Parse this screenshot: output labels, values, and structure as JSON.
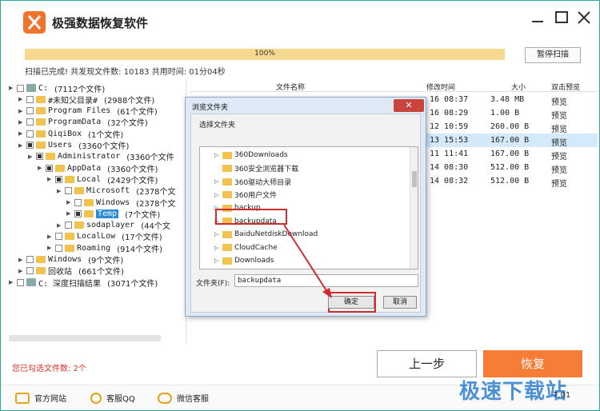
{
  "app": {
    "title": "极强数据恢复软件"
  },
  "progress": {
    "value": 1.0,
    "text": "100%"
  },
  "pause_button": "暂停扫描",
  "status": "扫描已完成! 共发现文件数: 10183  共用时间: 01分04秒",
  "tree": [
    {
      "label": "C:",
      "count": "(7112个文件)",
      "level": 0
    },
    {
      "label": "#未知父目录#",
      "count": "(2988个文件)",
      "level": 1
    },
    {
      "label": "Program Files",
      "count": "(61个文件)",
      "level": 1
    },
    {
      "label": "ProgramData",
      "count": "(32个文件)",
      "level": 1
    },
    {
      "label": "QiqiBox",
      "count": "(1个文件)",
      "level": 1
    },
    {
      "label": "Users",
      "count": "(3360个文件)",
      "level": 1
    },
    {
      "label": "Administrator",
      "count": "(3360个文件",
      "level": 2
    },
    {
      "label": "AppData",
      "count": "(3360个文件)",
      "level": 3
    },
    {
      "label": "Local",
      "count": "(2429个文件)",
      "level": 4
    },
    {
      "label": "Microsoft",
      "count": "(2378个文",
      "level": 5
    },
    {
      "label": "Windows",
      "count": "(2378个文",
      "level": 6
    },
    {
      "label": "Temp",
      "count": "(7个文件)",
      "level": 6
    },
    {
      "label": "sodaplayer",
      "count": "(44个文",
      "level": 5
    },
    {
      "label": "LocalLow",
      "count": "(17个文件)",
      "level": 4
    },
    {
      "label": "Roaming",
      "count": "(914个文件)",
      "level": 4
    },
    {
      "label": "Windows",
      "count": "(9个文件)",
      "level": 1
    },
    {
      "label": "回收站",
      "count": "(661个文件)",
      "level": 1
    },
    {
      "label": "C: 深度扫描结果",
      "count": "(3071个文件)",
      "level": 0
    }
  ],
  "file_list": {
    "headers": {
      "name": "文件名称",
      "modified": "修改时间",
      "size": "大小",
      "preview": "双击预览"
    },
    "rows": [
      {
        "modified": "16 08:37",
        "size": "3.48 MB",
        "preview": "预览"
      },
      {
        "modified": "16 08:29",
        "size": "1.00 B",
        "preview": "预览"
      },
      {
        "modified": "12 10:59",
        "size": "260.00 B",
        "preview": "预览"
      },
      {
        "modified": "13 15:53",
        "size": "167.00 B",
        "preview": "预览"
      },
      {
        "modified": "11 11:41",
        "size": "167.00 B",
        "preview": "预览"
      },
      {
        "modified": "14 08:30",
        "size": "512.00 B",
        "preview": "预览"
      },
      {
        "modified": "14 08:32",
        "size": "512.00 B",
        "preview": "预览"
      }
    ]
  },
  "selected_count": "您已勾选文件数: 2个",
  "buttons": {
    "prev": "上一步",
    "recover": "恢复"
  },
  "footer": {
    "website": "官方网站",
    "qq": "客服QQ",
    "wechat": "微信客服"
  },
  "watermark": {
    "main": "极速下载站",
    "small": "7.01"
  },
  "dialog": {
    "title": "浏览文件夹",
    "close": "✕",
    "prompt": "选择文件夹",
    "folders": [
      "360Downloads",
      "360安全浏览器下载",
      "360驱动大师目录",
      "360用户文件",
      "backup",
      "backupdata",
      "BaiduNetdiskDownload",
      "CloudCache",
      "Downloads"
    ],
    "folder_label": "文件夹(F):",
    "folder_value": "backupdata",
    "ok": "确定",
    "cancel": "取消"
  }
}
